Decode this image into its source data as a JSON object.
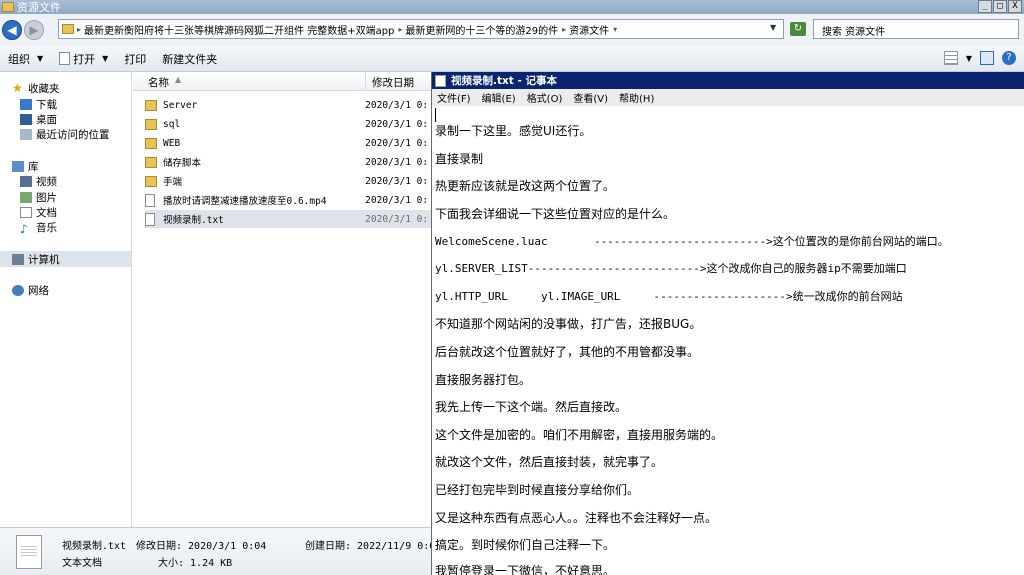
{
  "explorer": {
    "title": "资源文件",
    "window_buttons": {
      "minimize": "_",
      "maximize": "□",
      "close": "X"
    }
  },
  "address": {
    "segments": [
      "最新更新衡阳府将十三张等棋牌源码网狐二开组件 完整数据+双端app",
      "最新更新网的十三个等的游29的件",
      "资源文件"
    ],
    "search_placeholder": "搜索 资源文件"
  },
  "toolbar": {
    "organize": "组织",
    "open": "打开",
    "print": "打印",
    "new_folder": "新建文件夹"
  },
  "navpane": {
    "favorites": "收藏夹",
    "downloads": "下载",
    "desktop": "桌面",
    "recent": "最近访问的位置",
    "libraries": "库",
    "videos": "视频",
    "pictures": "图片",
    "documents": "文档",
    "music": "音乐",
    "computer": "计算机",
    "network": "网络"
  },
  "list": {
    "col_name": "名称",
    "col_date": "修改日期",
    "items": [
      {
        "name": "Server",
        "date": "2020/3/1 0:"
      },
      {
        "name": "sql",
        "date": "2020/3/1 0:"
      },
      {
        "name": "WEB",
        "date": "2020/3/1 0:"
      },
      {
        "name": "储存脚本",
        "date": "2020/3/1 0:"
      },
      {
        "name": "手端",
        "date": "2020/3/1 0:"
      },
      {
        "name": "播放时请调整减速播放速度至0.6.mp4",
        "date": "2020/3/1 0:"
      },
      {
        "name": "视频录制.txt",
        "date": "2020/3/1 0:"
      }
    ]
  },
  "details": {
    "filename": "视频录制.txt",
    "modified": "修改日期: 2020/3/1 0:04",
    "created": "创建日期: 2022/11/9 0:03",
    "type": "文本文档",
    "size": "大小: 1.24 KB"
  },
  "notepad": {
    "title": "视频录制.txt - 记事本",
    "menu": [
      "文件(F)",
      "编辑(E)",
      "格式(O)",
      "查看(V)",
      "帮助(H)"
    ],
    "lines": [
      "录制一下这里。感觉UI还行。",
      "直接录制",
      "热更新应该就是改这两个位置了。",
      "下面我会详细说一下这些位置对应的是什么。",
      "WelcomeScene.luac       -------------------------->这个位置改的是你前台网站的端口。",
      "yl.SERVER_LIST-------------------------->这个改成你自己的服务器ip不需要加端口",
      "yl.HTTP_URL     yl.IMAGE_URL     -------------------->统一改成你的前台网站",
      "不知道那个网站闲的没事做，打广告，还报BUG。",
      "后台就改这个位置就好了，其他的不用管都没事。",
      "直接服务器打包。",
      "我先上传一下这个端。然后直接改。",
      "这个文件是加密的。咱们不用解密，直接用服务端的。",
      "就改这个文件，然后直接封装，就完事了。",
      "已经打包完毕到时候直接分享给你们。",
      "又是这种东西有点恶心人。。注释也不会注释好一点。",
      "搞定。到时候你们自己注释一下。",
      "我暂停登录一下微信，不好意思。"
    ]
  }
}
